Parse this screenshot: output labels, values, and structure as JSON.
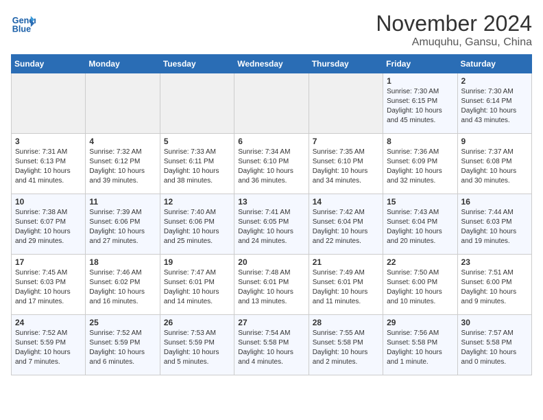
{
  "header": {
    "logo_line1": "General",
    "logo_line2": "Blue",
    "month_year": "November 2024",
    "location": "Amuquhu, Gansu, China"
  },
  "days_of_week": [
    "Sunday",
    "Monday",
    "Tuesday",
    "Wednesday",
    "Thursday",
    "Friday",
    "Saturday"
  ],
  "weeks": [
    [
      {
        "day": "",
        "empty": true
      },
      {
        "day": "",
        "empty": true
      },
      {
        "day": "",
        "empty": true
      },
      {
        "day": "",
        "empty": true
      },
      {
        "day": "",
        "empty": true
      },
      {
        "day": "1",
        "sunrise": "7:30 AM",
        "sunset": "6:15 PM",
        "daylight": "10 hours and 45 minutes."
      },
      {
        "day": "2",
        "sunrise": "7:30 AM",
        "sunset": "6:14 PM",
        "daylight": "10 hours and 43 minutes."
      }
    ],
    [
      {
        "day": "3",
        "sunrise": "7:31 AM",
        "sunset": "6:13 PM",
        "daylight": "10 hours and 41 minutes."
      },
      {
        "day": "4",
        "sunrise": "7:32 AM",
        "sunset": "6:12 PM",
        "daylight": "10 hours and 39 minutes."
      },
      {
        "day": "5",
        "sunrise": "7:33 AM",
        "sunset": "6:11 PM",
        "daylight": "10 hours and 38 minutes."
      },
      {
        "day": "6",
        "sunrise": "7:34 AM",
        "sunset": "6:10 PM",
        "daylight": "10 hours and 36 minutes."
      },
      {
        "day": "7",
        "sunrise": "7:35 AM",
        "sunset": "6:10 PM",
        "daylight": "10 hours and 34 minutes."
      },
      {
        "day": "8",
        "sunrise": "7:36 AM",
        "sunset": "6:09 PM",
        "daylight": "10 hours and 32 minutes."
      },
      {
        "day": "9",
        "sunrise": "7:37 AM",
        "sunset": "6:08 PM",
        "daylight": "10 hours and 30 minutes."
      }
    ],
    [
      {
        "day": "10",
        "sunrise": "7:38 AM",
        "sunset": "6:07 PM",
        "daylight": "10 hours and 29 minutes."
      },
      {
        "day": "11",
        "sunrise": "7:39 AM",
        "sunset": "6:06 PM",
        "daylight": "10 hours and 27 minutes."
      },
      {
        "day": "12",
        "sunrise": "7:40 AM",
        "sunset": "6:06 PM",
        "daylight": "10 hours and 25 minutes."
      },
      {
        "day": "13",
        "sunrise": "7:41 AM",
        "sunset": "6:05 PM",
        "daylight": "10 hours and 24 minutes."
      },
      {
        "day": "14",
        "sunrise": "7:42 AM",
        "sunset": "6:04 PM",
        "daylight": "10 hours and 22 minutes."
      },
      {
        "day": "15",
        "sunrise": "7:43 AM",
        "sunset": "6:04 PM",
        "daylight": "10 hours and 20 minutes."
      },
      {
        "day": "16",
        "sunrise": "7:44 AM",
        "sunset": "6:03 PM",
        "daylight": "10 hours and 19 minutes."
      }
    ],
    [
      {
        "day": "17",
        "sunrise": "7:45 AM",
        "sunset": "6:03 PM",
        "daylight": "10 hours and 17 minutes."
      },
      {
        "day": "18",
        "sunrise": "7:46 AM",
        "sunset": "6:02 PM",
        "daylight": "10 hours and 16 minutes."
      },
      {
        "day": "19",
        "sunrise": "7:47 AM",
        "sunset": "6:01 PM",
        "daylight": "10 hours and 14 minutes."
      },
      {
        "day": "20",
        "sunrise": "7:48 AM",
        "sunset": "6:01 PM",
        "daylight": "10 hours and 13 minutes."
      },
      {
        "day": "21",
        "sunrise": "7:49 AM",
        "sunset": "6:01 PM",
        "daylight": "10 hours and 11 minutes."
      },
      {
        "day": "22",
        "sunrise": "7:50 AM",
        "sunset": "6:00 PM",
        "daylight": "10 hours and 10 minutes."
      },
      {
        "day": "23",
        "sunrise": "7:51 AM",
        "sunset": "6:00 PM",
        "daylight": "10 hours and 9 minutes."
      }
    ],
    [
      {
        "day": "24",
        "sunrise": "7:52 AM",
        "sunset": "5:59 PM",
        "daylight": "10 hours and 7 minutes."
      },
      {
        "day": "25",
        "sunrise": "7:52 AM",
        "sunset": "5:59 PM",
        "daylight": "10 hours and 6 minutes."
      },
      {
        "day": "26",
        "sunrise": "7:53 AM",
        "sunset": "5:59 PM",
        "daylight": "10 hours and 5 minutes."
      },
      {
        "day": "27",
        "sunrise": "7:54 AM",
        "sunset": "5:58 PM",
        "daylight": "10 hours and 4 minutes."
      },
      {
        "day": "28",
        "sunrise": "7:55 AM",
        "sunset": "5:58 PM",
        "daylight": "10 hours and 2 minutes."
      },
      {
        "day": "29",
        "sunrise": "7:56 AM",
        "sunset": "5:58 PM",
        "daylight": "10 hours and 1 minute."
      },
      {
        "day": "30",
        "sunrise": "7:57 AM",
        "sunset": "5:58 PM",
        "daylight": "10 hours and 0 minutes."
      }
    ]
  ]
}
